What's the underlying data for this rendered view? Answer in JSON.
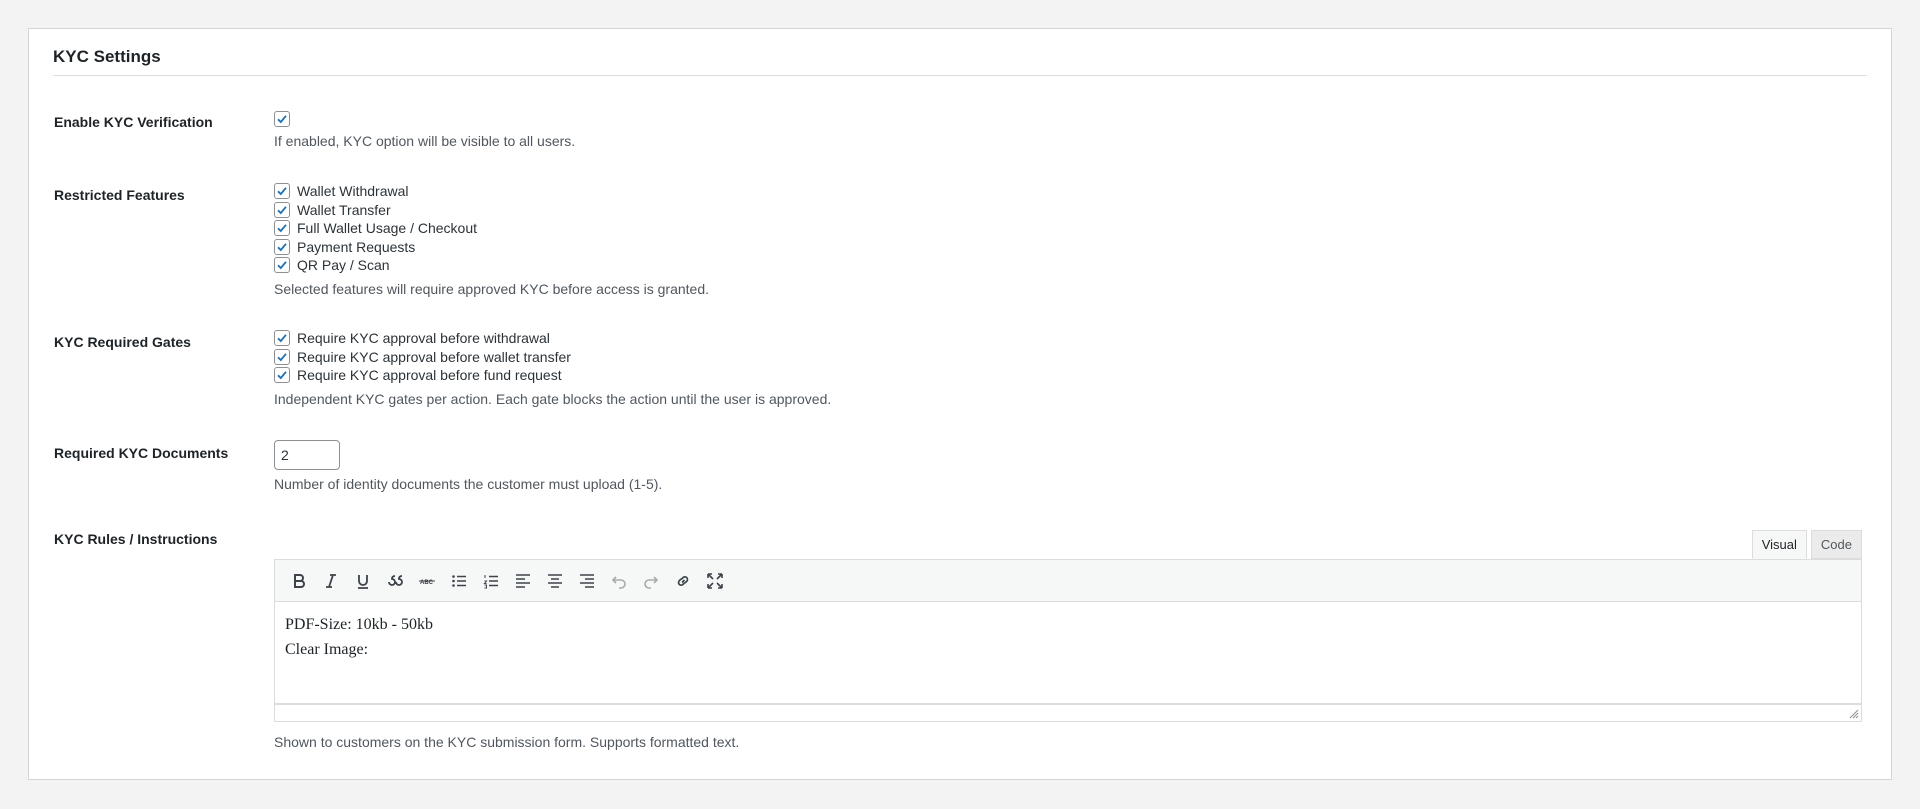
{
  "section": {
    "title": "KYC Settings"
  },
  "enable_kyc": {
    "label": "Enable KYC Verification",
    "checked": true,
    "description": "If enabled, KYC option will be visible to all users."
  },
  "restricted_features": {
    "label": "Restricted Features",
    "options": [
      {
        "label": "Wallet Withdrawal",
        "checked": true
      },
      {
        "label": "Wallet Transfer",
        "checked": true
      },
      {
        "label": "Full Wallet Usage / Checkout",
        "checked": true
      },
      {
        "label": "Payment Requests",
        "checked": true
      },
      {
        "label": "QR Pay / Scan",
        "checked": true
      }
    ],
    "description": "Selected features will require approved KYC before access is granted."
  },
  "required_gates": {
    "label": "KYC Required Gates",
    "options": [
      {
        "label": "Require KYC approval before withdrawal",
        "checked": true
      },
      {
        "label": "Require KYC approval before wallet transfer",
        "checked": true
      },
      {
        "label": "Require KYC approval before fund request",
        "checked": true
      }
    ],
    "description": "Independent KYC gates per action. Each gate blocks the action until the user is approved."
  },
  "required_documents": {
    "label": "Required KYC Documents",
    "value": "2",
    "description": "Number of identity documents the customer must upload (1-5)."
  },
  "rules": {
    "label": "KYC Rules / Instructions",
    "tabs": {
      "visual": "Visual",
      "code": "Code",
      "active": "visual"
    },
    "toolbar_icons": [
      "bold-icon",
      "italic-icon",
      "underline-icon",
      "blockquote-icon",
      "strikethrough-icon",
      "bullet-list-icon",
      "numbered-list-icon",
      "align-left-icon",
      "align-center-icon",
      "align-right-icon",
      "undo-icon",
      "redo-icon",
      "link-icon",
      "fullscreen-icon"
    ],
    "content": {
      "line1": "PDF-Size: 10kb - 50kb",
      "line2": "Clear Image:"
    },
    "description": "Shown to customers on the KYC submission form. Supports formatted text."
  },
  "colors": {
    "accent": "#2271b1",
    "text": "#1d2327",
    "muted": "#50575e",
    "border": "#dcdcde"
  }
}
